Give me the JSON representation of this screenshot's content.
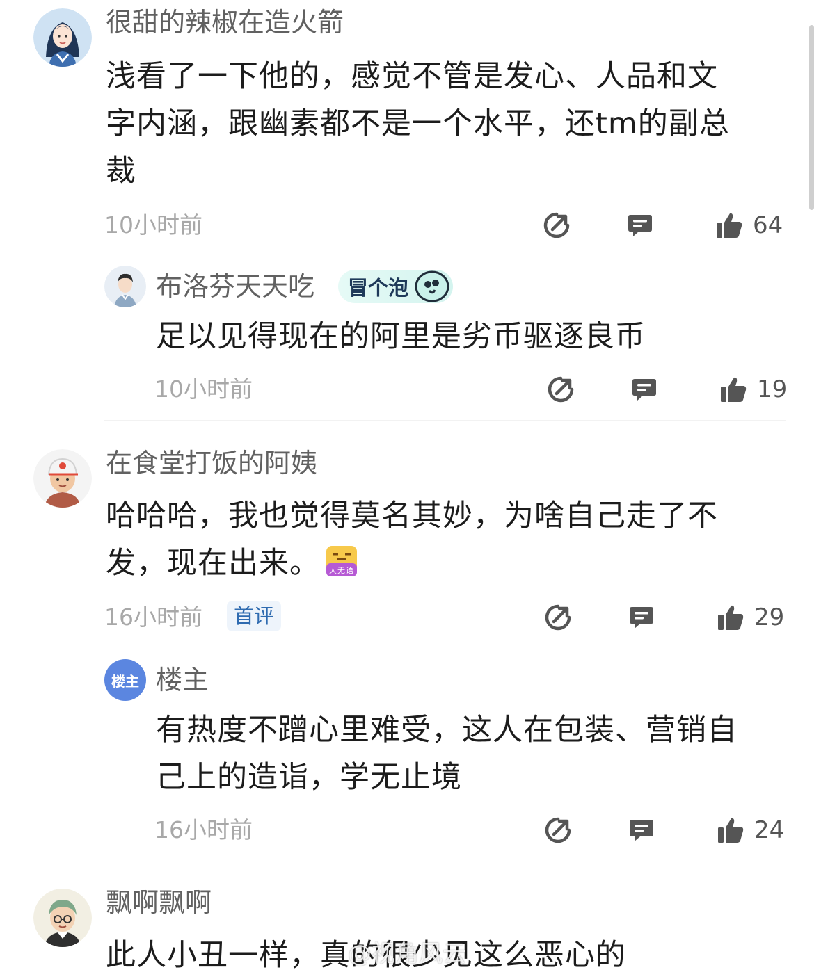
{
  "comments": [
    {
      "name": "很甜的辣椒在造火箭",
      "lines": [
        "浅看了一下他的，感觉不管是发心、人品和文",
        "字内涵，跟幽素都不是一个水平，还tm的副总",
        "裁"
      ],
      "time": "10小时前",
      "likes": "64",
      "avatar_icon": "woman-avatar-icon"
    },
    {
      "name": "布洛芬天天吃",
      "badge": "冒个泡",
      "lines": [
        "足以见得现在的阿里是劣币驱逐良币"
      ],
      "time": "10小时前",
      "likes": "19",
      "avatar_icon": "man-avatar-icon"
    },
    {
      "name": "在食堂打饭的阿姨",
      "lines": [
        "哈哈哈，我也觉得莫名其妙，为啥自己走了不",
        "发，现在出来。"
      ],
      "sticker_text": "大无语",
      "time": "16小时前",
      "tag": "首评",
      "likes": "29",
      "avatar_icon": "cap-boy-avatar-icon"
    },
    {
      "name": "楼主",
      "avatar_text": "楼主",
      "lines": [
        "有热度不蹭心里难受，这人在包装、营销自",
        "己上的造诣，学无止境"
      ],
      "time": "16小时前",
      "likes": "24",
      "avatar_icon": "op-badge-avatar"
    },
    {
      "name": "飘啊飘啊",
      "lines": [
        "此人小丑一样，真的很少见这么恶心的"
      ],
      "avatar_icon": "man-glasses-avatar-icon"
    }
  ],
  "watermark": "@视角风云",
  "colors": {
    "text": "#1c1c1c",
    "meta": "#a8a8a8",
    "name": "#616161",
    "tag_blue": "#2f6bb0"
  }
}
